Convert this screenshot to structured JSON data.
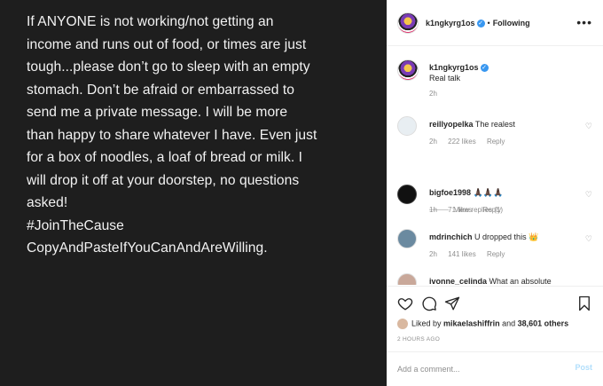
{
  "post": {
    "text": "If ANYONE is not working/not getting an\nincome and runs out of food, or times are just\ntough...please don’t go to sleep with an empty\nstomach. Don’t be afraid or embarrassed to\nsend me a private message. I will be more\nthan happy to share whatever I have. Even just\nfor a box of noodles, a loaf of bread or milk. I\nwill drop it off at your doorstep, no questions\nasked!\n#JoinTheCause\nCopyAndPasteIfYouCanAndAreWilling."
  },
  "header": {
    "username": "k1ngkyrg1os",
    "verified_glyph": "✓",
    "separator": "•",
    "follow_status": "Following",
    "more_glyph": "•••"
  },
  "caption": {
    "username": "k1ngkyrg1os",
    "text": "Real talk",
    "age": "2h"
  },
  "comments": [
    {
      "username": "reillyopelka",
      "text": "The realest",
      "age": "2h",
      "likes": "222 likes",
      "reply": "Reply"
    },
    {
      "username": "bigfoe1998",
      "text": "🙏🏿🙏🏿🙏🏿",
      "age": "1h",
      "likes": "71 likes",
      "reply": "Reply"
    },
    {
      "username": "mdrinchich",
      "text": "U dropped this 👑",
      "age": "2h",
      "likes": "141 likes",
      "reply": "Reply"
    },
    {
      "username": "ivonne_celinda",
      "text": "What an absolute",
      "age": "",
      "likes": "",
      "reply": ""
    }
  ],
  "view_replies": "View replies (1)",
  "likes": {
    "prefix": "Liked by",
    "user": "mikaelashiffrin",
    "middle": "and",
    "others": "38,601 others"
  },
  "timestamp": "2 HOURS AGO",
  "add_comment": {
    "placeholder": "Add a comment...",
    "post_label": "Post"
  },
  "icons": {
    "heart": "heart-icon",
    "comment": "comment-icon",
    "share": "share-icon",
    "save": "bookmark-icon"
  },
  "colors": {
    "verified": "#3897f0",
    "post_disabled": "#b2dffc",
    "muted": "#8e8e8e"
  }
}
